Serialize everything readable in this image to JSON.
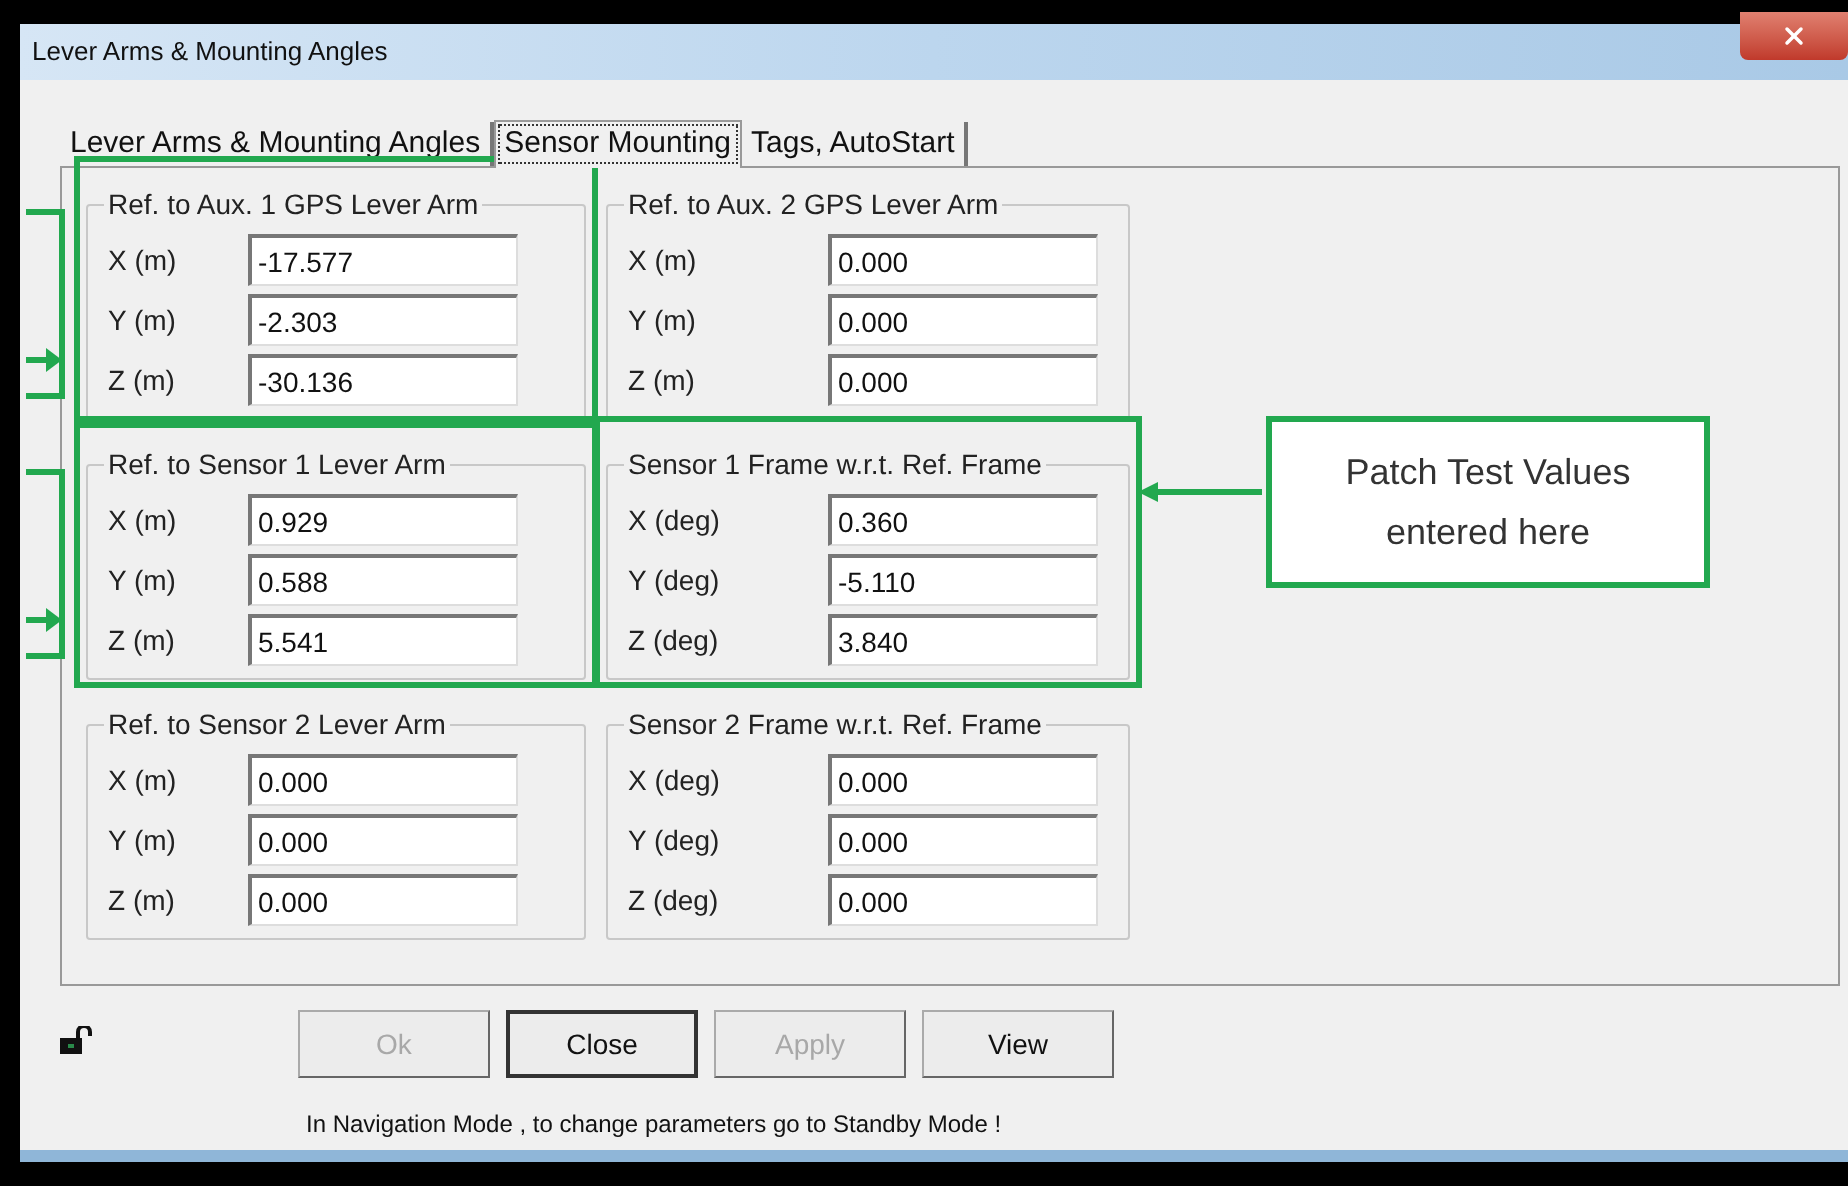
{
  "window": {
    "title": "Lever Arms & Mounting Angles"
  },
  "tabs": [
    {
      "label": "Lever Arms & Mounting Angles",
      "selected": false
    },
    {
      "label": "Sensor Mounting",
      "selected": true
    },
    {
      "label": "Tags, AutoStart",
      "selected": false
    }
  ],
  "groups": [
    {
      "title": "Ref. to Aux. 1 GPS Lever Arm",
      "highlighted": true,
      "kind": "bracket",
      "fields": [
        {
          "label": "X (m)",
          "value": "-17.577"
        },
        {
          "label": "Y (m)",
          "value": "-2.303"
        },
        {
          "label": "Z (m)",
          "value": "-30.136"
        }
      ]
    },
    {
      "title": "Ref. to Aux. 2 GPS Lever Arm",
      "highlighted": false,
      "fields": [
        {
          "label": "X (m)",
          "value": "0.000"
        },
        {
          "label": "Y (m)",
          "value": "0.000"
        },
        {
          "label": "Z (m)",
          "value": "0.000"
        }
      ]
    },
    {
      "title": "Ref. to Sensor 1 Lever Arm",
      "highlighted": true,
      "kind": "bracket",
      "fields": [
        {
          "label": "X (m)",
          "value": "0.929"
        },
        {
          "label": "Y (m)",
          "value": "0.588"
        },
        {
          "label": "Z (m)",
          "value": "5.541"
        }
      ]
    },
    {
      "title": "Sensor 1 Frame w.r.t. Ref. Frame",
      "highlighted": true,
      "kind": "callout",
      "callout": "Patch Test Values entered here",
      "fields": [
        {
          "label": "X (deg)",
          "value": "0.360"
        },
        {
          "label": "Y (deg)",
          "value": "-5.110"
        },
        {
          "label": "Z (deg)",
          "value": "3.840"
        }
      ]
    },
    {
      "title": "Ref. to Sensor 2 Lever Arm",
      "highlighted": false,
      "fields": [
        {
          "label": "X (m)",
          "value": "0.000"
        },
        {
          "label": "Y (m)",
          "value": "0.000"
        },
        {
          "label": "Z (m)",
          "value": "0.000"
        }
      ]
    },
    {
      "title": "Sensor 2 Frame w.r.t. Ref. Frame",
      "highlighted": false,
      "fields": [
        {
          "label": "X (deg)",
          "value": "0.000"
        },
        {
          "label": "Y (deg)",
          "value": "0.000"
        },
        {
          "label": "Z (deg)",
          "value": "0.000"
        }
      ]
    }
  ],
  "buttons": [
    {
      "label": "Ok",
      "disabled": true,
      "default": false
    },
    {
      "label": "Close",
      "disabled": false,
      "default": true
    },
    {
      "label": "Apply",
      "disabled": true,
      "default": false
    },
    {
      "label": "View",
      "disabled": false,
      "default": false
    }
  ],
  "status_message": "In Navigation Mode , to change parameters go to Standby Mode !"
}
